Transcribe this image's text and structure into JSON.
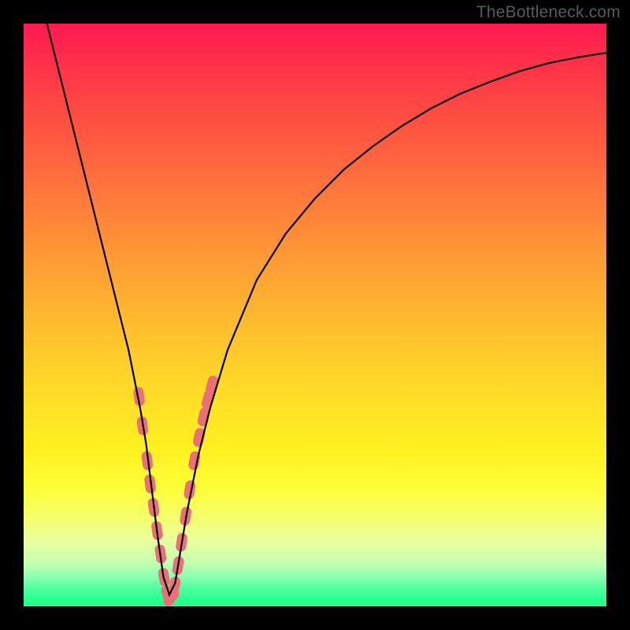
{
  "watermark": "TheBottleneck.com",
  "chart_data": {
    "type": "line",
    "title": "",
    "xlabel": "",
    "ylabel": "",
    "xlim": [
      0,
      100
    ],
    "ylim": [
      0,
      100
    ],
    "series": [
      {
        "name": "curve",
        "x": [
          4,
          6,
          8,
          10,
          12,
          14,
          16,
          18,
          20,
          21,
          22,
          23,
          24,
          25,
          26,
          27,
          28,
          30,
          32,
          35,
          40,
          45,
          50,
          55,
          60,
          65,
          70,
          75,
          80,
          85,
          90,
          95,
          100
        ],
        "y": [
          100,
          92,
          84,
          76,
          68,
          60,
          52,
          44,
          34,
          28,
          20,
          12,
          5,
          2,
          4,
          10,
          16,
          26,
          34,
          44,
          56,
          64,
          70,
          75,
          79,
          82.5,
          85.5,
          88,
          90,
          91.8,
          93.2,
          94.2,
          95
        ]
      }
    ],
    "markers": {
      "name": "highlight-segments",
      "color": "#e96f78",
      "x": [
        19.8,
        20.4,
        21.2,
        21.7,
        22.3,
        22.9,
        23.5,
        24.1,
        24.7,
        25.3,
        25.9,
        26.5,
        27.1,
        27.8,
        28.5,
        29.3,
        30.1,
        30.9,
        31.6,
        32.3
      ],
      "y": [
        36,
        31,
        25,
        21,
        17,
        13,
        9,
        5,
        2,
        1.5,
        3.5,
        7,
        11,
        15.5,
        20,
        25,
        29,
        32.5,
        35.5,
        38
      ]
    }
  },
  "colors": {
    "curve": "#000000",
    "marker": "#e96f78",
    "frame": "#000000"
  }
}
